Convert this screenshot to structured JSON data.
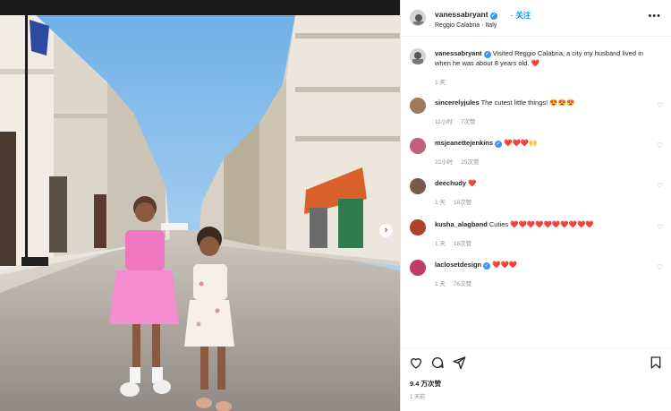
{
  "header": {
    "username": "vanessabryant",
    "follow_label": "关注",
    "location": "Reggio Calabria · Italy",
    "more_label": "•••"
  },
  "caption": {
    "username": "vanessabryant",
    "text": "Visited Reggio Calabria, a city my husband lived in when he was about 8 years old.",
    "emoji": "❤️",
    "time": "1 天"
  },
  "comments": [
    {
      "username": "sincerelyjules",
      "verified": false,
      "text": "The cutest little things!",
      "emoji": "😍😍😍",
      "time": "11小时",
      "likes": "7次赞"
    },
    {
      "username": "msjeanettejenkins",
      "verified": true,
      "text": "",
      "emoji": "❤️❤️❤️🙌",
      "time": "22小时",
      "likes": "25次赞"
    },
    {
      "username": "deechudy",
      "verified": false,
      "text": "",
      "emoji": "❤️",
      "time": "1 天",
      "likes": "18次赞"
    },
    {
      "username": "kusha_alagband",
      "verified": false,
      "text": "Cuties",
      "emoji": "❤️❤️❤️❤️❤️❤️❤️❤️❤️❤️",
      "time": "1 天",
      "likes": "18次赞"
    },
    {
      "username": "laclosetdesign",
      "verified": true,
      "text": "",
      "emoji": "❤️❤️❤️",
      "time": "1 天",
      "likes": "76次赞"
    }
  ],
  "footer": {
    "likes_count": "9.4 万次赞",
    "post_time": "1 天前"
  },
  "photo": {
    "next_label": "›",
    "slide_count": 6,
    "active_slide": 1
  },
  "colors": {
    "accent": "#0095f6",
    "heart": "#ed4956",
    "muted": "#8e8e8e"
  }
}
